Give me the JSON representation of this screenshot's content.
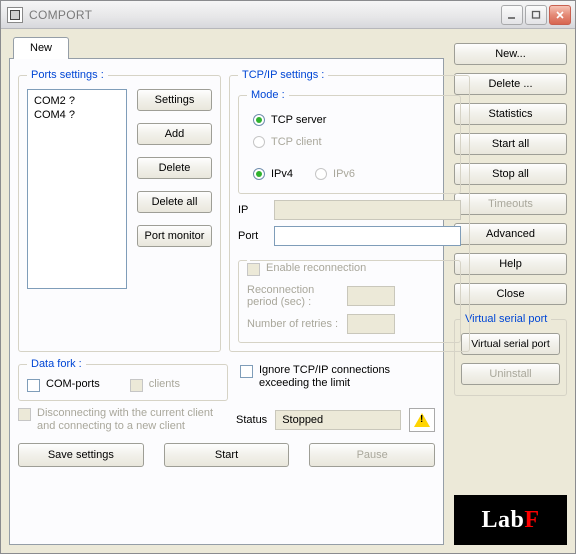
{
  "window": {
    "title": "COMPORT"
  },
  "tab": {
    "label": "New"
  },
  "ports": {
    "legend": "Ports settings :",
    "items": [
      "COM2 ?",
      "COM4 ?"
    ],
    "buttons": {
      "settings": "Settings",
      "add": "Add",
      "delete": "Delete",
      "delete_all": "Delete all",
      "port_monitor": "Port monitor"
    }
  },
  "tcpip": {
    "legend": "TCP/IP settings :",
    "mode": {
      "legend": "Mode :",
      "server": "TCP server",
      "client": "TCP client",
      "ipv4": "IPv4",
      "ipv6": "IPv6"
    },
    "ip_label": "IP",
    "port_label": "Port",
    "reconnection": {
      "enable": "Enable reconnection",
      "period_label": "Reconnection period (sec) :",
      "retries_label": "Number of retries :"
    },
    "ignore_label": "Ignore TCP/IP connections exceeding the limit",
    "status_label": "Status",
    "status_value": "Stopped"
  },
  "datafork": {
    "legend": "Data fork :",
    "com_ports": "COM-ports",
    "clients": "clients",
    "disconnect_note": "Disconnecting with the current client and connecting to a new client"
  },
  "bottom": {
    "save": "Save settings",
    "start": "Start",
    "pause": "Pause"
  },
  "sidebar": {
    "new": "New...",
    "delete": "Delete ...",
    "statistics": "Statistics",
    "start_all": "Start all",
    "stop_all": "Stop all",
    "timeouts": "Timeouts",
    "advanced": "Advanced",
    "help": "Help",
    "close": "Close"
  },
  "vsp": {
    "legend": "Virtual serial port",
    "button": "Virtual serial port",
    "uninstall": "Uninstall"
  },
  "logo": {
    "lab": "Lab",
    "f": "F"
  }
}
